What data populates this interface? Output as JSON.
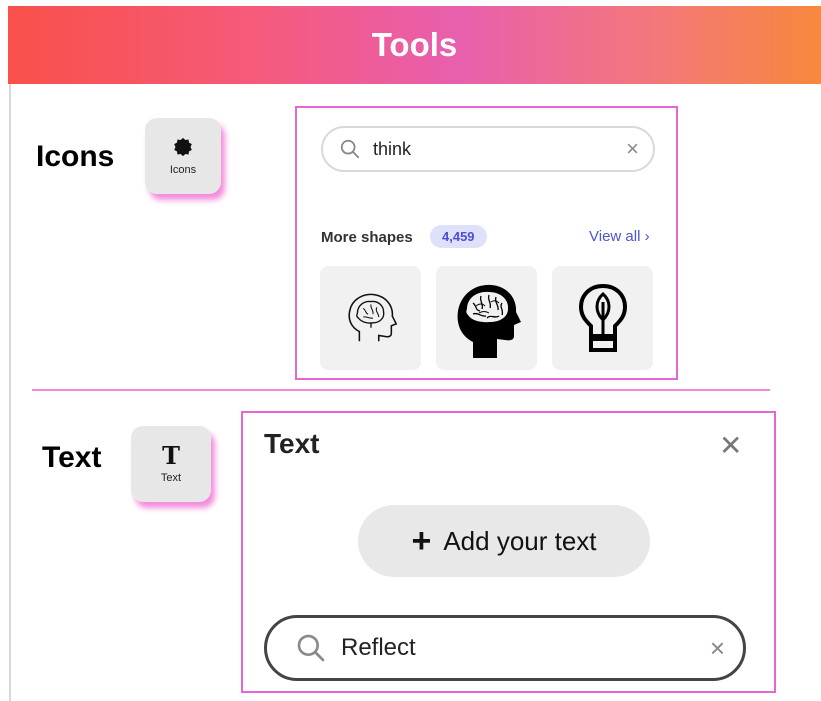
{
  "header": {
    "title": "Tools"
  },
  "icons_section": {
    "label": "Icons",
    "tile_label": "Icons",
    "panel": {
      "search_value": "think",
      "clear_symbol": "×",
      "more_shapes_label": "More shapes",
      "count": "4,459",
      "view_all_label": "View all ›",
      "results": [
        {
          "icon": "head-brain-outline-icon"
        },
        {
          "icon": "head-brain-silhouette-icon"
        },
        {
          "icon": "lightbulb-leaf-icon"
        }
      ]
    }
  },
  "text_section": {
    "label": "Text",
    "tile_glyph": "T",
    "tile_label": "Text",
    "panel": {
      "title": "Text",
      "close_symbol": "✕",
      "add_text_label": "Add your text",
      "add_symbol": "+",
      "search_value": "Reflect",
      "clear_symbol": "×"
    }
  },
  "colors": {
    "accent_magenta": "#e766d6",
    "badge_text": "#4b4fd1",
    "link": "#4b56c9"
  }
}
